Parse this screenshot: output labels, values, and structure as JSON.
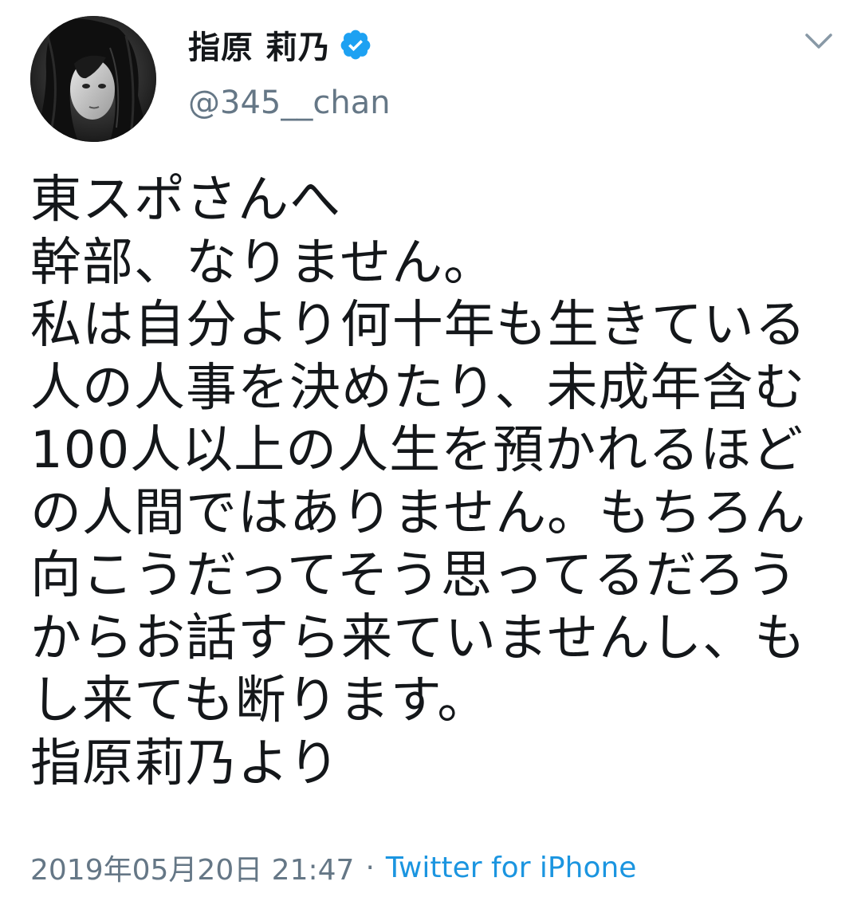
{
  "tweet": {
    "author": {
      "display_name": "指原 莉乃",
      "handle": "@345__chan",
      "verified": true,
      "avatar_icon": "profile-photo",
      "verified_icon": "verified-badge-icon"
    },
    "menu_icon": "chevron-down-icon",
    "lines": [
      "東スポさんへ",
      "幹部、なりません。",
      "私は自分より何十年も生きている",
      "人の人事を決めたり、未成年含む",
      "100人以上の人生を預かれるほど",
      "の人間ではありません。もちろん",
      "向こうだってそう思ってるだろう",
      "からお話すら来ていませんし、も",
      "し来ても断ります。",
      "指原莉乃より"
    ],
    "timestamp": "2019年05月20日 21:47",
    "separator": "·",
    "source": "Twitter for iPhone"
  },
  "colors": {
    "text": "#14171a",
    "secondary": "#657786",
    "link": "#1b95e0",
    "verified": "#1da1f2"
  }
}
